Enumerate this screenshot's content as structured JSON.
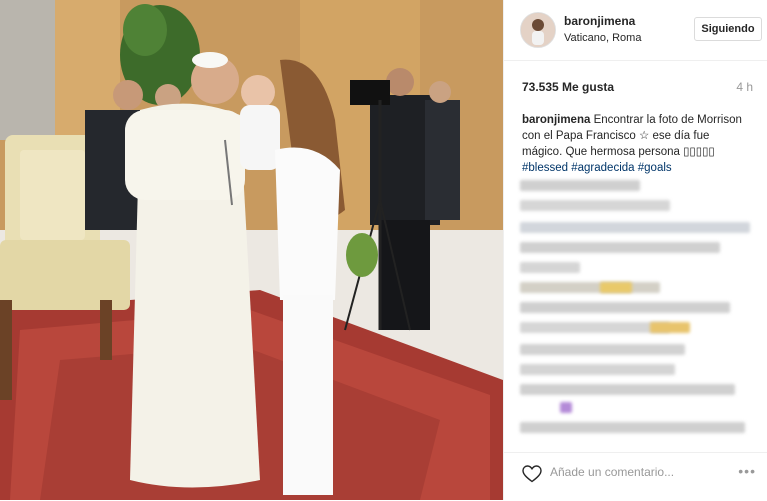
{
  "post": {
    "username": "baronjimena",
    "location": "Vaticano, Roma",
    "follow_label": "Siguiendo",
    "likes": "73.535 Me gusta",
    "time": "4 h",
    "caption_user": "baronjimena",
    "caption_text": "Encontrar la foto de Morrison con el Papa Francisco ☆ ese día fue mágico. Que hermosa persona ▯▯▯▯▯",
    "hashtags": [
      "#blessed",
      "#agradecida",
      "#goals"
    ],
    "comment_placeholder": "Añade un comentario...",
    "more_label": "•••"
  },
  "icons": [
    "heart-icon",
    "more-options-icon"
  ],
  "colors": {
    "hashtag": "#003569",
    "text": "#262626",
    "muted": "#999999",
    "border": "#dbdbdb"
  }
}
